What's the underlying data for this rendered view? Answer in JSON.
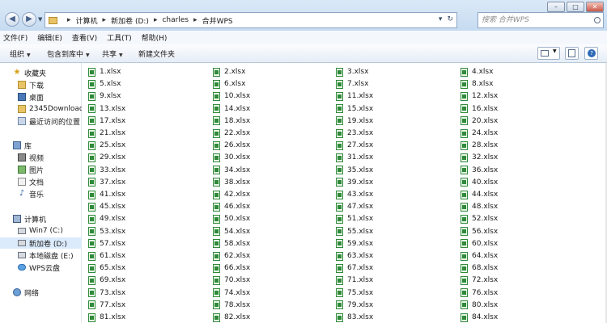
{
  "address": {
    "breadcrumbs": [
      "计算机",
      "新加卷 (D:)",
      "charles",
      "合并WPS"
    ]
  },
  "search": {
    "placeholder": "搜索 合并WPS"
  },
  "menu": [
    "文件(F)",
    "编辑(E)",
    "查看(V)",
    "工具(T)",
    "帮助(H)"
  ],
  "toolbar": {
    "organize": "组织",
    "include_in_library": "包含到库中",
    "share": "共享",
    "new_folder": "新建文件夹"
  },
  "sidebar": {
    "favorites": "收藏夹",
    "downloads": "下载",
    "desktop": "桌面",
    "downloads2345": "2345Downloads",
    "recent": "最近访问的位置",
    "libraries": "库",
    "videos": "视频",
    "pictures": "图片",
    "documents": "文档",
    "music": "音乐",
    "computer": "计算机",
    "drive_c": "Win7 (C:)",
    "drive_d": "新加卷 (D:)",
    "drive_e": "本地磁盘 (E:)",
    "wps_cloud": "WPS云盘",
    "network": "网络"
  },
  "files": [
    "1.xlsx",
    "2.xlsx",
    "3.xlsx",
    "4.xlsx",
    "5.xlsx",
    "6.xlsx",
    "7.xlsx",
    "8.xlsx",
    "9.xlsx",
    "10.xlsx",
    "11.xlsx",
    "12.xlsx",
    "13.xlsx",
    "14.xlsx",
    "15.xlsx",
    "16.xlsx",
    "17.xlsx",
    "18.xlsx",
    "19.xlsx",
    "20.xlsx",
    "21.xlsx",
    "22.xlsx",
    "23.xlsx",
    "24.xlsx",
    "25.xlsx",
    "26.xlsx",
    "27.xlsx",
    "28.xlsx",
    "29.xlsx",
    "30.xlsx",
    "31.xlsx",
    "32.xlsx",
    "33.xlsx",
    "34.xlsx",
    "35.xlsx",
    "36.xlsx",
    "37.xlsx",
    "38.xlsx",
    "39.xlsx",
    "40.xlsx",
    "41.xlsx",
    "42.xlsx",
    "43.xlsx",
    "44.xlsx",
    "45.xlsx",
    "46.xlsx",
    "47.xlsx",
    "48.xlsx",
    "49.xlsx",
    "50.xlsx",
    "51.xlsx",
    "52.xlsx",
    "53.xlsx",
    "54.xlsx",
    "55.xlsx",
    "56.xlsx",
    "57.xlsx",
    "58.xlsx",
    "59.xlsx",
    "60.xlsx",
    "61.xlsx",
    "62.xlsx",
    "63.xlsx",
    "64.xlsx",
    "65.xlsx",
    "66.xlsx",
    "67.xlsx",
    "68.xlsx",
    "69.xlsx",
    "70.xlsx",
    "71.xlsx",
    "72.xlsx",
    "73.xlsx",
    "74.xlsx",
    "75.xlsx",
    "76.xlsx",
    "77.xlsx",
    "78.xlsx",
    "79.xlsx",
    "80.xlsx",
    "81.xlsx",
    "82.xlsx",
    "83.xlsx",
    "84.xlsx"
  ]
}
